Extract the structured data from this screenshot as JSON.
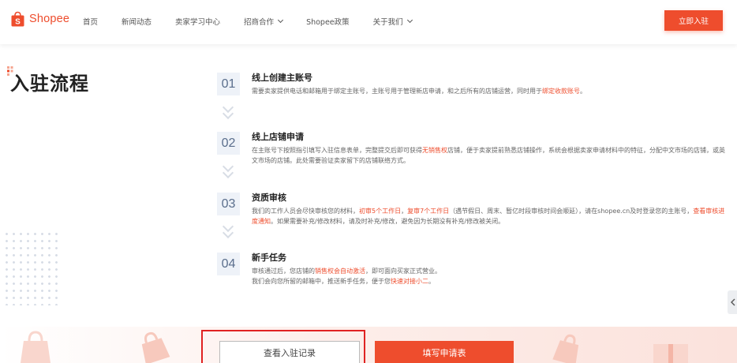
{
  "header": {
    "logo_text": "Shopee",
    "nav": [
      {
        "label": "首页",
        "has_dropdown": false
      },
      {
        "label": "新闻动态",
        "has_dropdown": false
      },
      {
        "label": "卖家学习中心",
        "has_dropdown": false
      },
      {
        "label": "招商合作",
        "has_dropdown": true
      },
      {
        "label": "Shopee政策",
        "has_dropdown": false
      },
      {
        "label": "关于我们",
        "has_dropdown": true
      }
    ],
    "join_button": "立即入驻"
  },
  "section_title": "入驻流程",
  "steps": [
    {
      "num": "01",
      "title": "线上创建主账号",
      "desc": [
        {
          "t": "需要卖家提供电话和邮箱用于绑定主账号，主账号用于管理新店申请，和之后所有的店铺运营，同时用于"
        },
        {
          "t": "绑定收款账号",
          "hl": true
        },
        {
          "t": "。"
        }
      ]
    },
    {
      "num": "02",
      "title": "线上店铺申请",
      "desc": [
        {
          "t": "在主账号下按照指引填写入驻信息表单，完整提交后即可获得"
        },
        {
          "t": "无销售权",
          "hl": true
        },
        {
          "t": "店铺，便于卖家提前熟悉店铺操作，系统会根据卖家申请材料中的特征，分配中文市场的店铺，或英文市场的店铺。此处需要验证卖家留下的店铺联络方式。"
        }
      ]
    },
    {
      "num": "03",
      "title": "资质审核",
      "desc": [
        {
          "t": "我们的工作人员会尽快审核您的材料，"
        },
        {
          "t": "初审5个工作日",
          "hl": true
        },
        {
          "t": "，"
        },
        {
          "t": "复审7个工作日",
          "hl": true
        },
        {
          "t": "（遇节假日、周末、暂亿时段审核时间会顺延），请在shopee.cn及时登录您的主账号，"
        },
        {
          "t": "查看审核进度通知",
          "hl": true
        },
        {
          "t": "。如果需要补充/修改材料，请及时补充/修改，避免因为长期没有补充/修改被关闭。"
        }
      ]
    },
    {
      "num": "04",
      "title": "新手任务",
      "desc": [
        {
          "t": "审核通过后，您店铺的"
        },
        {
          "t": "销售权会自动激活",
          "hl": true
        },
        {
          "t": "，即可面向买家正式营业。"
        },
        {
          "t": "\n"
        },
        {
          "t": "我们会向您所留的邮箱中，推送新手任务，便于您"
        },
        {
          "t": "快速对接小二",
          "hl": true
        },
        {
          "t": "。"
        }
      ]
    }
  ],
  "buttons": {
    "view_record": "查看入驻记录",
    "fill_form": "填写申请表"
  },
  "colors": {
    "brand": "#ee4d2d",
    "number_bg": "#eef2f8",
    "number_text": "#5a6e8c",
    "highlight_frame": "#e02222"
  }
}
